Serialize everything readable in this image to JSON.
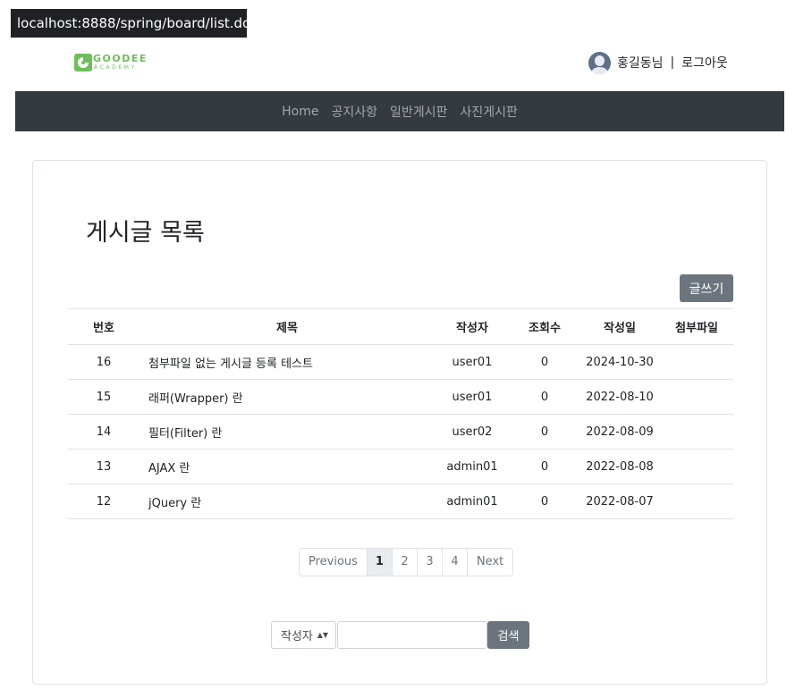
{
  "browser": {
    "status_url": "localhost:8888/spring/board/list.do"
  },
  "header": {
    "logo_text": "GOODEE",
    "logo_sub": "ACADEMY",
    "user_name": "홍길동님",
    "separator": "|",
    "logout": "로그아웃"
  },
  "nav": {
    "items": [
      "Home",
      "공지사항",
      "일반게시판",
      "사진게시판"
    ]
  },
  "page": {
    "title": "게시글 목록",
    "write_button": "글쓰기"
  },
  "table": {
    "headers": [
      "번호",
      "제목",
      "작성자",
      "조회수",
      "작성일",
      "첨부파일"
    ],
    "rows": [
      {
        "no": "16",
        "title": "첨부파일 없는 게시글 등록 테스트",
        "author": "user01",
        "views": "0",
        "date": "2024-10-30",
        "file": ""
      },
      {
        "no": "15",
        "title": "래퍼(Wrapper) 란",
        "author": "user01",
        "views": "0",
        "date": "2022-08-10",
        "file": ""
      },
      {
        "no": "14",
        "title": "필터(Filter) 란",
        "author": "user02",
        "views": "0",
        "date": "2022-08-09",
        "file": ""
      },
      {
        "no": "13",
        "title": "AJAX 란",
        "author": "admin01",
        "views": "0",
        "date": "2022-08-08",
        "file": ""
      },
      {
        "no": "12",
        "title": "jQuery 란",
        "author": "admin01",
        "views": "0",
        "date": "2022-08-07",
        "file": ""
      }
    ]
  },
  "pagination": {
    "previous": "Previous",
    "pages": [
      "1",
      "2",
      "3",
      "4"
    ],
    "next": "Next",
    "current": "1"
  },
  "search": {
    "selected_option": "작성자",
    "input_value": "",
    "button": "검색"
  },
  "colors": {
    "navbar": "#343a40",
    "button": "#6c757d",
    "logo": "#6cbf5a",
    "avatar": "#5e6f86"
  }
}
